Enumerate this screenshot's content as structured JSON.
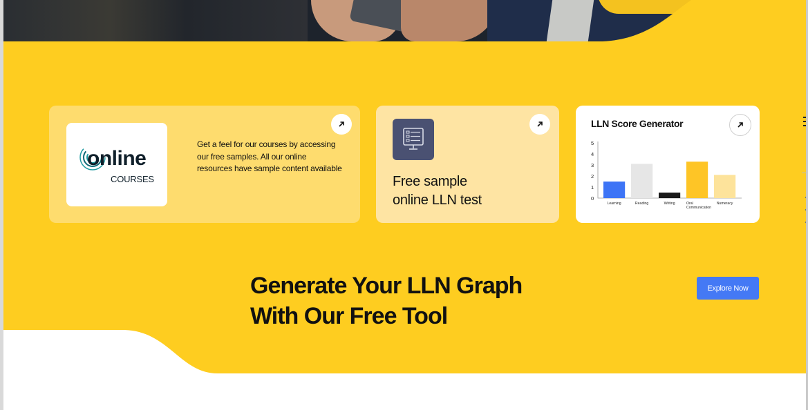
{
  "colors": {
    "brand_yellow": "#fecd20",
    "card_light_yellow": "#fedc6e",
    "card_pale_yellow": "#fee4a3",
    "cta_blue": "#4479f5"
  },
  "cards": [
    {
      "logo": {
        "word": "online",
        "sub": "COURSES"
      },
      "description": "Get a feel for our courses by accessing our free samples. All our online resources have sample content available",
      "arrow_icon": "arrow-up-right-icon"
    },
    {
      "icon": "computer-test-icon",
      "title_line1": "Free sample",
      "title_line2": "online LLN test",
      "arrow_icon": "arrow-up-right-icon"
    },
    {
      "title": "LLN Score Generator",
      "arrow_icon": "arrow-up-right-icon"
    }
  ],
  "chart_data": {
    "type": "bar",
    "title": "LLN Score Generator",
    "categories": [
      "Learning",
      "Reading",
      "Writing",
      "Oral Communication",
      "Numeracy"
    ],
    "values": [
      1.5,
      3.1,
      0.5,
      3.3,
      2.1
    ],
    "bar_colors": [
      "#3d74f6",
      "#e6e6e6",
      "#1a1a1a",
      "#fec526",
      "#fde39b"
    ],
    "ylim": [
      0,
      5
    ],
    "yticks": [
      0,
      1,
      2,
      3,
      4,
      5
    ],
    "xlabel": "",
    "ylabel": "",
    "grid": false
  },
  "cta": {
    "heading_line1": "Generate Your LLN Graph",
    "heading_line2": "With Our Free Tool",
    "button_label": "Explore Now"
  }
}
